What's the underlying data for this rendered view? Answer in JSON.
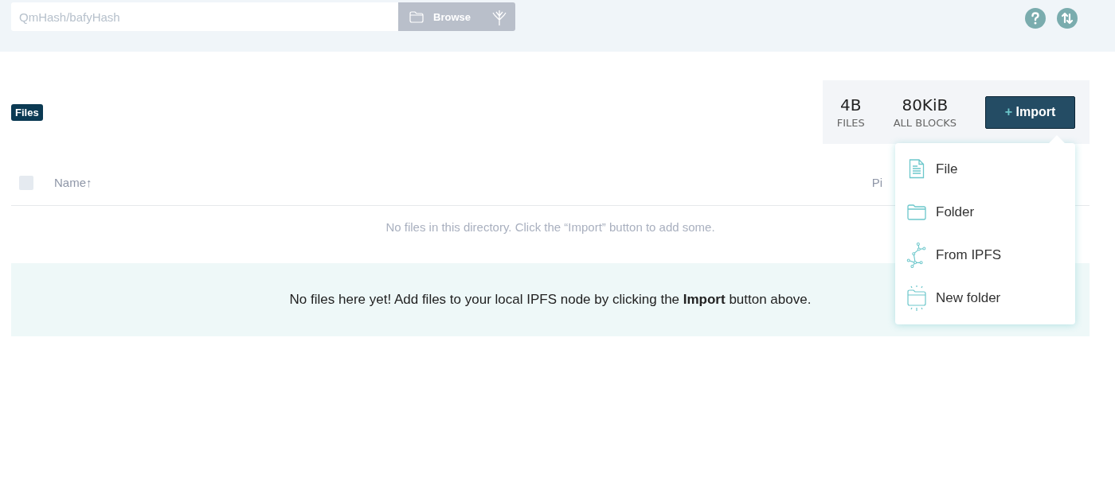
{
  "header": {
    "search": {
      "placeholder": "QmHash/bafyHash"
    },
    "browse_button": "Browse"
  },
  "breadcrumb": "Files",
  "stats": [
    {
      "value": "4B",
      "label": "FILES"
    },
    {
      "value": "80KiB",
      "label": "ALL BLOCKS"
    }
  ],
  "import_button": {
    "plus": "+",
    "label": "Import",
    "expanded": true
  },
  "import_menu": [
    {
      "kind": "file",
      "label": "File"
    },
    {
      "kind": "folder",
      "label": "Folder"
    },
    {
      "kind": "ipfs",
      "label": "From IPFS"
    },
    {
      "kind": "new-folder",
      "label": "New folder"
    }
  ],
  "table": {
    "select_all": {
      "checked": false
    },
    "columns": [
      {
        "label": "Name",
        "sort": "↑"
      },
      {
        "label": "Pi"
      }
    ],
    "empty_message": "No files in this directory. Click the “Import” button to add some."
  },
  "notice": "No files here yet! Add files to your local IPFS node by clicking the **Import** button above."
}
